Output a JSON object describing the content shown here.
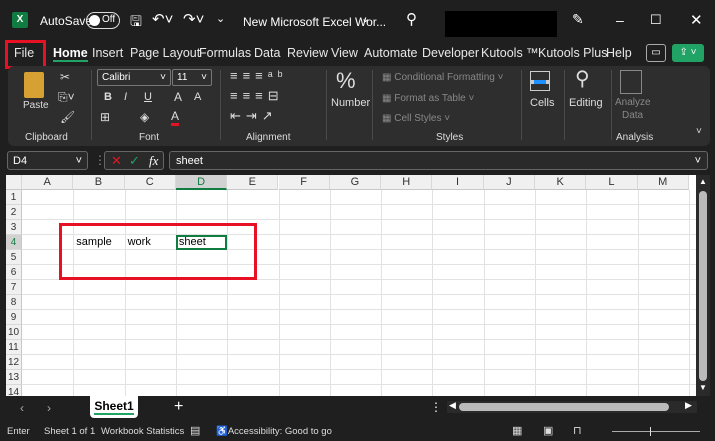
{
  "titlebar": {
    "app_icon": "X",
    "autosave_label": "AutoSave",
    "autosave_state": "Off",
    "doc_title": "New Microsoft Excel Wor...",
    "icons": [
      "save-icon",
      "undo-icon",
      "redo-icon",
      "search-icon",
      "pen-icon",
      "minimize-icon",
      "maximize-icon",
      "close-icon"
    ]
  },
  "tabs": [
    "File",
    "Home",
    "Insert",
    "Page Layout",
    "Formulas",
    "Data",
    "Review",
    "View",
    "Automate",
    "Developer",
    "Kutools ™",
    "Kutools Plus",
    "Help"
  ],
  "active_tab": "Home",
  "ribbon": {
    "clipboard": {
      "paste": "Paste",
      "label": "Clipboard"
    },
    "font": {
      "name": "Calibri",
      "size": "11",
      "bold": "B",
      "italic": "I",
      "underline": "U",
      "grow": "A",
      "shrink": "A",
      "color": "A",
      "label": "Font",
      "font_color": "#e81123"
    },
    "alignment": {
      "label": "Alignment"
    },
    "number": {
      "symbol": "%",
      "label": "Number"
    },
    "styles": {
      "conditional": "Conditional Formatting",
      "table": "Format as Table",
      "cell_styles": "Cell Styles",
      "label": "Styles"
    },
    "cells": {
      "label": "Cells"
    },
    "editing": {
      "label": "Editing"
    },
    "analysis": {
      "analyze": "Analyze",
      "data": "Data",
      "label": "Analysis"
    }
  },
  "formula_bar": {
    "name_box": "D4",
    "fx": "fx",
    "value": "sheet"
  },
  "columns": [
    "A",
    "B",
    "C",
    "D",
    "E",
    "F",
    "G",
    "H",
    "I",
    "J",
    "K",
    "L",
    "M"
  ],
  "rows": [
    "1",
    "2",
    "3",
    "4",
    "5",
    "6",
    "7",
    "8",
    "9",
    "10",
    "11",
    "12",
    "13",
    "14"
  ],
  "cells": {
    "B4": "sample",
    "C4": "work",
    "D4": "sheet"
  },
  "selected_cell": "D4",
  "sheet_tabs": {
    "sheets": [
      "Sheet1"
    ],
    "add": "+"
  },
  "status": {
    "mode": "Enter",
    "sheet": "Sheet 1 of 1",
    "stats": "Workbook Statistics",
    "accessibility": "Accessibility: Good to go"
  },
  "colors": {
    "accent": "#21a366",
    "highlight": "#e81123",
    "share": "#21a366"
  }
}
